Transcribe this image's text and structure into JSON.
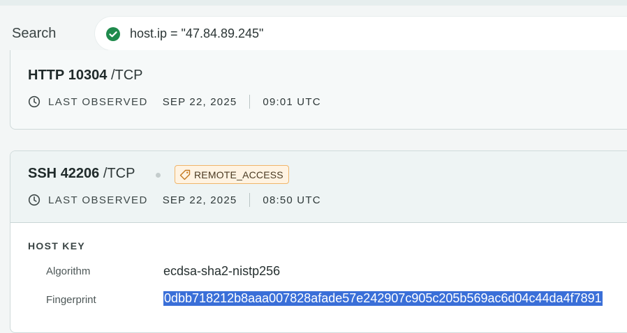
{
  "search": {
    "label": "Search",
    "query": "host.ip = \"47.84.89.245\"",
    "status_icon": "check-circle-icon",
    "status_color": "#1f8a4c"
  },
  "services": [
    {
      "name": "HTTP",
      "port": "10304",
      "protocol": "/TCP",
      "observed_label": "LAST OBSERVED",
      "observed_date": "SEP 22, 2025",
      "observed_time": "09:01 UTC"
    },
    {
      "name": "SSH",
      "port": "42206",
      "protocol": "/TCP",
      "tag": "REMOTE_ACCESS",
      "tag_color": "#f0b56a",
      "observed_label": "LAST OBSERVED",
      "observed_date": "SEP 22, 2025",
      "observed_time": "08:50 UTC",
      "host_key": {
        "title": "HOST KEY",
        "rows": [
          {
            "key": "Algorithm",
            "value": "ecdsa-sha2-nistp256"
          },
          {
            "key": "Fingerprint",
            "value": "0dbb718212b8aaa007828afade57e242907c905c205b569ac6d04c44da4f7891"
          }
        ]
      }
    }
  ]
}
